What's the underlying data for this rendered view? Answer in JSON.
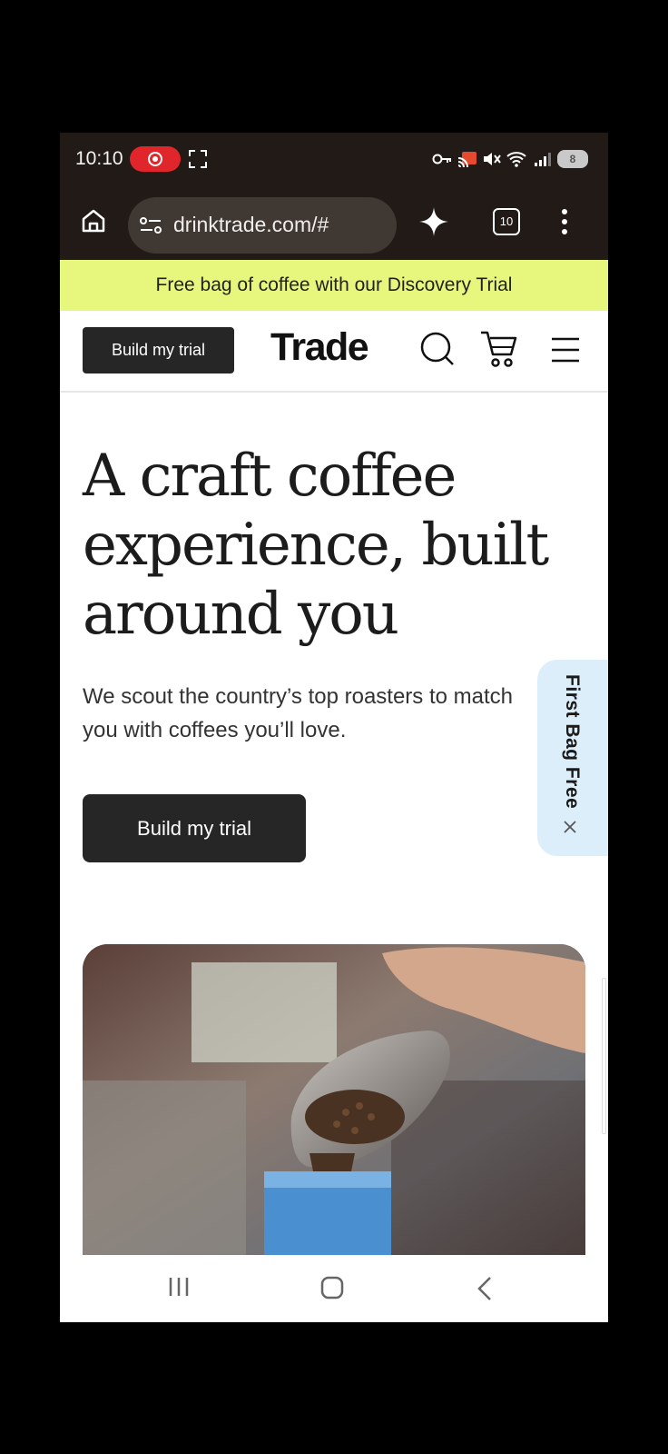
{
  "status_bar": {
    "time": "10:10",
    "battery_level": "8"
  },
  "browser": {
    "url": "drinktrade.com/#",
    "tab_count": "10"
  },
  "announcement": {
    "text": "Free bag of coffee with our Discovery Trial"
  },
  "header": {
    "trial_button": "Build my trial",
    "logo": "Trade"
  },
  "hero": {
    "title": "A craft coffee experience, built around you",
    "subtitle": "We scout the country’s top roasters to match you with coffees you’ll love.",
    "cta": "Build my trial"
  },
  "promo_tab": {
    "label": "First Bag Free"
  },
  "colors": {
    "announcement_bg": "#e7f77e",
    "button_dark": "#262626",
    "promo_bg": "#ddeefb",
    "browser_chrome": "#211a16",
    "record_red": "#e0262b"
  }
}
